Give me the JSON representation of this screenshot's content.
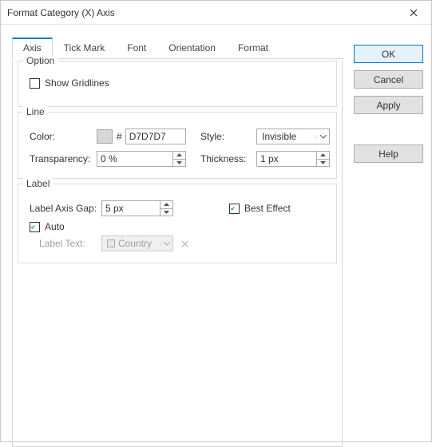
{
  "title": "Format Category (X) Axis",
  "tabs": [
    "Axis",
    "Tick Mark",
    "Font",
    "Orientation",
    "Format"
  ],
  "activeTab": 0,
  "buttons": {
    "ok": "OK",
    "cancel": "Cancel",
    "apply": "Apply",
    "help": "Help"
  },
  "option": {
    "legend": "Option",
    "showGridlines": {
      "label": "Show Gridlines",
      "checked": false
    }
  },
  "line": {
    "legend": "Line",
    "colorLabel": "Color:",
    "hashSymbol": "#",
    "colorHex": "D7D7D7",
    "styleLabel": "Style:",
    "styleValue": "Invisible",
    "transparencyLabel": "Transparency:",
    "transparencyValue": "0 %",
    "thicknessLabel": "Thickness:",
    "thicknessValue": "1 px"
  },
  "label": {
    "legend": "Label",
    "gapLabel": "Label Axis Gap:",
    "gapValue": "5 px",
    "bestEffect": {
      "label": "Best Effect",
      "checked": true
    },
    "auto": {
      "label": "Auto",
      "checked": true
    },
    "labelTextLabel": "Label Text:",
    "labelTextValue": "Country"
  }
}
